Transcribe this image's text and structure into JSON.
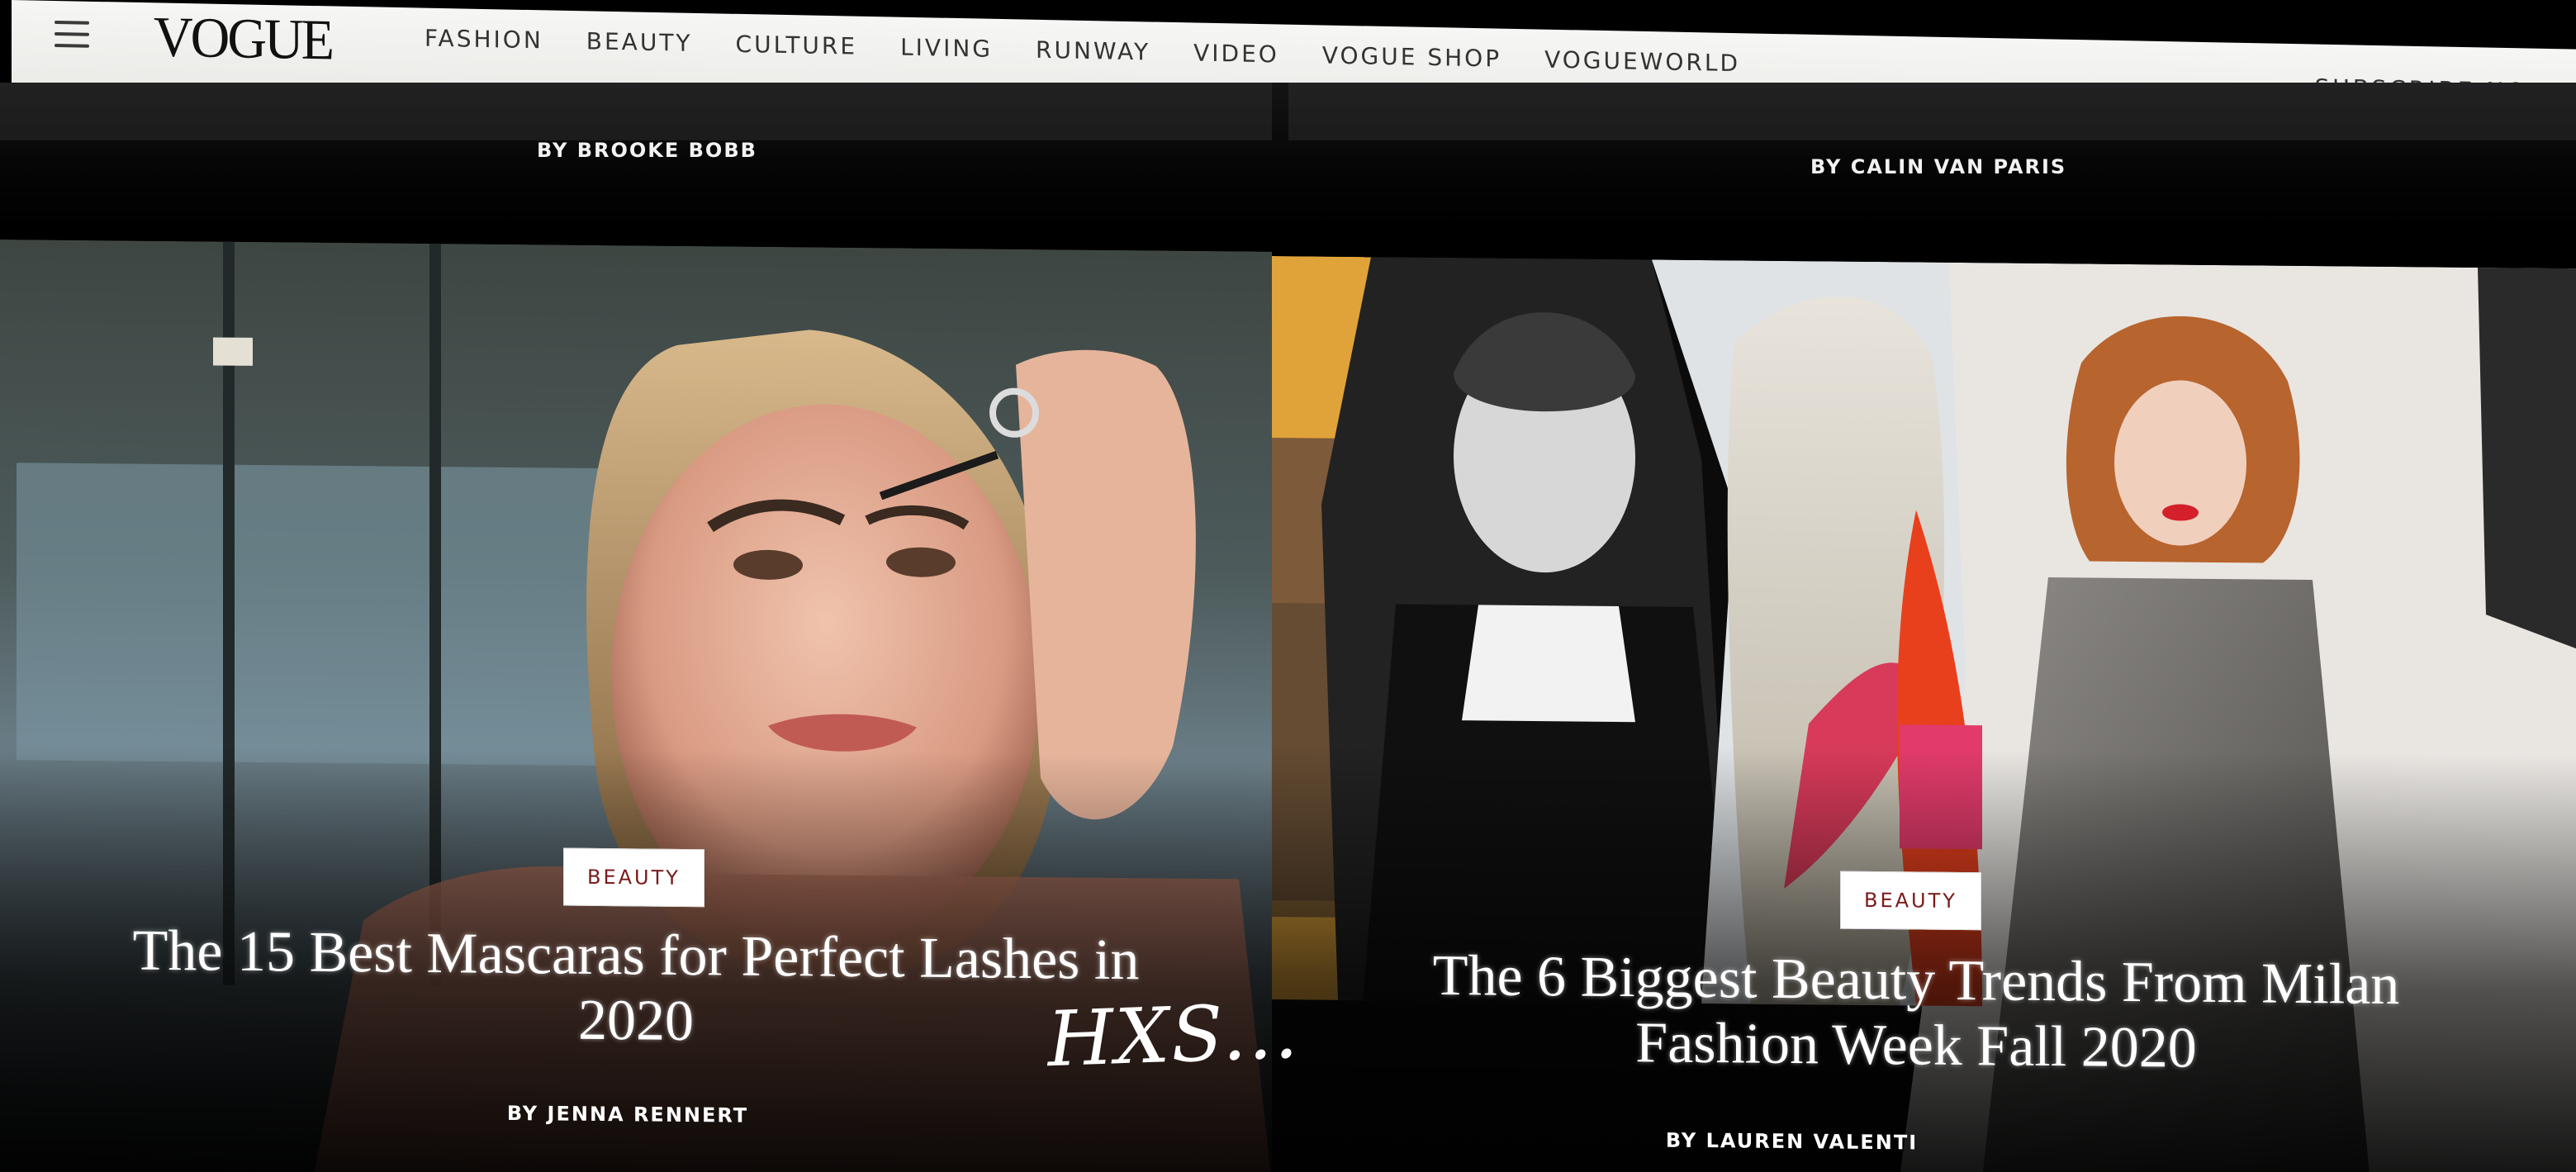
{
  "header": {
    "logo": "VOGUE",
    "nav": [
      "FASHION",
      "BEAUTY",
      "CULTURE",
      "LIVING",
      "RUNWAY",
      "VIDEO",
      "VOGUE SHOP",
      "VOGUEWORLD"
    ],
    "subscribe": "SUBSCRIBE NOW"
  },
  "previous_row": {
    "left_byline": "BY BROOKE BOBB",
    "right_byline": "BY CALIN VAN PARIS"
  },
  "articles": [
    {
      "category": "BEAUTY",
      "title_line1": "The 15 Best Mascaras for Perfect Lashes in",
      "title_line2": "2020",
      "byline": "BY JENNA RENNERT"
    },
    {
      "category": "BEAUTY",
      "title_line1": "The 6 Biggest Beauty Trends From Milan",
      "title_line2": "Fashion Week Fall 2020",
      "byline": "BY LAUREN VALENTI"
    }
  ],
  "watermark": "HXS...",
  "colors": {
    "nav_bg": "#efefec",
    "badge_text": "#7a1a1a",
    "page_bg": "#000000"
  }
}
